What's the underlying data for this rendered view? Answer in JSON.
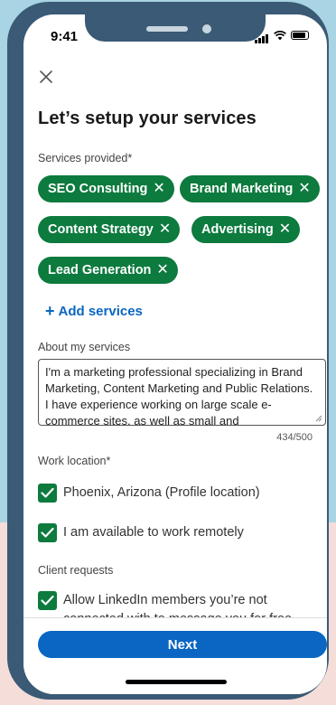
{
  "status": {
    "time": "9:41"
  },
  "page": {
    "title": "Let’s setup your services"
  },
  "services": {
    "label": "Services provided*",
    "chips": [
      "SEO Consulting",
      "Brand Marketing",
      "Content Strategy",
      "Advertising",
      "Lead Generation"
    ],
    "add_label": "Add services"
  },
  "about": {
    "label": "About my services",
    "text": "I'm a marketing professional specializing in Brand Marketing, Content Marketing and Public Relations. I have experience working on large scale e-commerce sites, as well as small and",
    "counter": "434/500"
  },
  "work_location": {
    "label": "Work location*",
    "options": [
      {
        "text": "Phoenix, Arizona (Profile location)",
        "checked": true
      },
      {
        "text": "I am available to work remotely",
        "checked": true
      }
    ]
  },
  "client_requests": {
    "label": "Client requests",
    "options": [
      {
        "text": "Allow LinkedIn members you’re not connected with to message you for free",
        "checked": true
      }
    ]
  },
  "footer": {
    "next_label": "Next"
  },
  "colors": {
    "chip_green": "#0d7a3e",
    "primary_blue": "#0a66c2",
    "frame": "#3a5a75"
  }
}
